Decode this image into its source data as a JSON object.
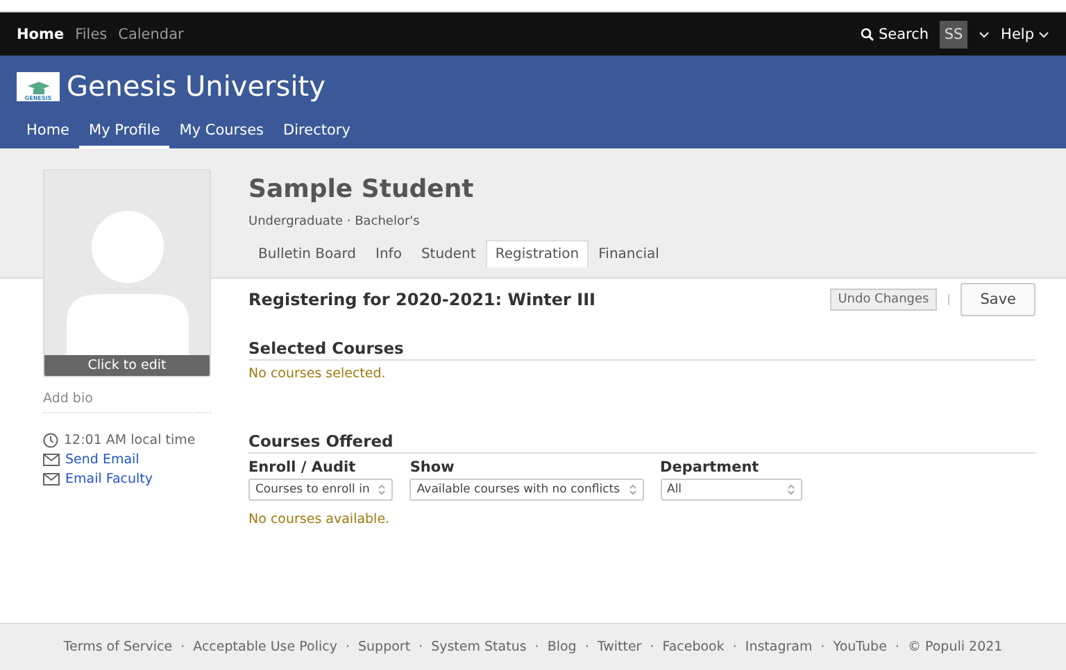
{
  "top_nav": {
    "links": [
      {
        "label": "Home",
        "selected": true
      },
      {
        "label": "Files",
        "selected": false
      },
      {
        "label": "Calendar",
        "selected": false
      }
    ],
    "search": "Search",
    "user_initials": "SS",
    "help": "Help"
  },
  "header": {
    "university": "Genesis University",
    "logo_text": "GENESIS",
    "nav": [
      {
        "label": "Home",
        "selected": false
      },
      {
        "label": "My Profile",
        "selected": true
      },
      {
        "label": "My Courses",
        "selected": false
      },
      {
        "label": "Directory",
        "selected": false
      }
    ]
  },
  "profile": {
    "name": "Sample Student",
    "subtitle": "Undergraduate · Bachelor's",
    "photo_caption": "Click to edit",
    "add_bio": "Add bio",
    "local_time": "12:01 AM local time",
    "links": [
      "Send Email",
      "Email Faculty"
    ],
    "tabs": [
      {
        "label": "Bulletin Board",
        "selected": false
      },
      {
        "label": "Info",
        "selected": false
      },
      {
        "label": "Student",
        "selected": false
      },
      {
        "label": "Registration",
        "selected": true
      },
      {
        "label": "Financial",
        "selected": false
      }
    ]
  },
  "registration": {
    "title": "Registering for 2020-2021: Winter III",
    "undo": "Undo Changes",
    "save": "Save",
    "selected_heading": "Selected Courses",
    "selected_empty": "No courses selected.",
    "offered_heading": "Courses Offered",
    "filters": [
      {
        "label": "Enroll / Audit",
        "value": "Courses to enroll in"
      },
      {
        "label": "Show",
        "value": "Available courses with no conflicts"
      },
      {
        "label": "Department",
        "value": "All"
      }
    ],
    "offered_empty": "No courses available."
  },
  "footer": {
    "separator": "·",
    "links": [
      "Terms of Service",
      "Acceptable Use Policy",
      "Support",
      "System Status",
      "Blog",
      "Twitter",
      "Facebook",
      "Instagram",
      "YouTube",
      "© Populi 2021"
    ]
  }
}
